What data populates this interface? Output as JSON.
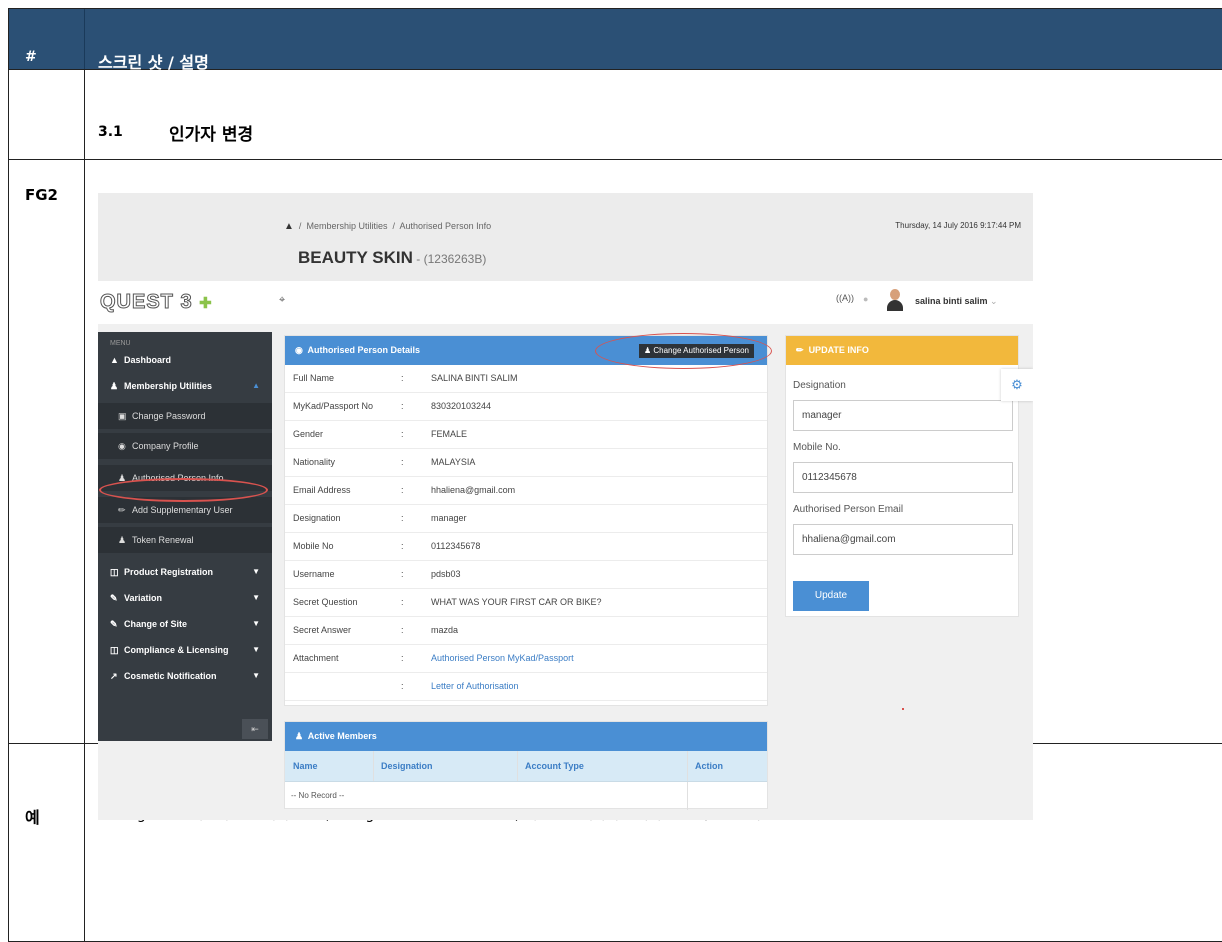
{
  "header": {
    "hash": "#",
    "title": "스크린 샷 / 설명"
  },
  "section": {
    "number": "3.1",
    "title": "인가자 변경"
  },
  "figure_label": "FG2",
  "example_label": "예",
  "caption": "Figure 2: 사용자는 '인가자 변경'(Change Authorized Person) 버튼을 클릭하여 인가자를 신청/등록한다.",
  "screenshot": {
    "breadcrumb": [
      "Membership Utilities",
      "Authorised Person Info"
    ],
    "breadcrumb_separator": "/",
    "datetime": "Thursday, 14 July 2016 9:17:44 PM",
    "company_name": "BEAUTY SKIN",
    "company_reg": " - (1236263B)",
    "logo_text": "QUEST 3",
    "logo_plus": "✚",
    "username": "salina binti salim",
    "menu_title": "MENU",
    "sidebar": [
      {
        "label": "Dashboard",
        "icon": "home-icon"
      },
      {
        "label": "Membership Utilities",
        "icon": "user-icon"
      },
      {
        "label": "Change Password",
        "icon": "lock-icon"
      },
      {
        "label": "Company Profile",
        "icon": "eye-icon"
      },
      {
        "label": "Authorised Person Info",
        "icon": "user-icon"
      },
      {
        "label": "Add Supplementary User",
        "icon": "pencil-icon"
      },
      {
        "label": "Token Renewal",
        "icon": "users-icon"
      },
      {
        "label": "Product Registration",
        "icon": "copy-icon"
      },
      {
        "label": "Variation",
        "icon": "edit-icon"
      },
      {
        "label": "Change of Site",
        "icon": "edit-icon"
      },
      {
        "label": "Compliance & Licensing",
        "icon": "copy-icon"
      },
      {
        "label": "Cosmetic Notification",
        "icon": "syringe-icon"
      }
    ],
    "details_panel": {
      "title": "Authorised Person Details",
      "change_button": "Change Authorised Person",
      "colon": ":",
      "rows": [
        {
          "label": "Full Name",
          "value": "SALINA BINTI SALIM"
        },
        {
          "label": "MyKad/Passport No",
          "value": "830320103244"
        },
        {
          "label": "Gender",
          "value": "FEMALE"
        },
        {
          "label": "Nationality",
          "value": "MALAYSIA"
        },
        {
          "label": "Email Address",
          "value": "hhaliena@gmail.com"
        },
        {
          "label": "Designation",
          "value": "manager"
        },
        {
          "label": "Mobile No",
          "value": "0112345678"
        },
        {
          "label": "Username",
          "value": "pdsb03"
        },
        {
          "label": "Secret Question",
          "value": "WHAT WAS YOUR FIRST CAR OR BIKE?"
        },
        {
          "label": "Secret Answer",
          "value": "mazda"
        },
        {
          "label": "Attachment",
          "value": "Authorised Person MyKad/Passport"
        },
        {
          "label": "",
          "value": "Letter of Authorisation"
        }
      ]
    },
    "update_panel": {
      "title": "UPDATE INFO",
      "designation_label": "Designation",
      "designation_value": "manager",
      "mobile_label": "Mobile No.",
      "mobile_value": "0112345678",
      "email_label": "Authorised Person Email",
      "email_value": "hhaliena@gmail.com",
      "button": "Update"
    },
    "members_panel": {
      "title": "Active Members",
      "columns": [
        "Name",
        "Designation",
        "Account Type",
        "Action"
      ],
      "empty_text": "-- No Record --"
    },
    "colors": {
      "blue": "#4a8fd4",
      "orange": "#f2b83c",
      "sidebar": "#363c42",
      "header": "#2b5075",
      "highlight": "#d9534f"
    }
  }
}
